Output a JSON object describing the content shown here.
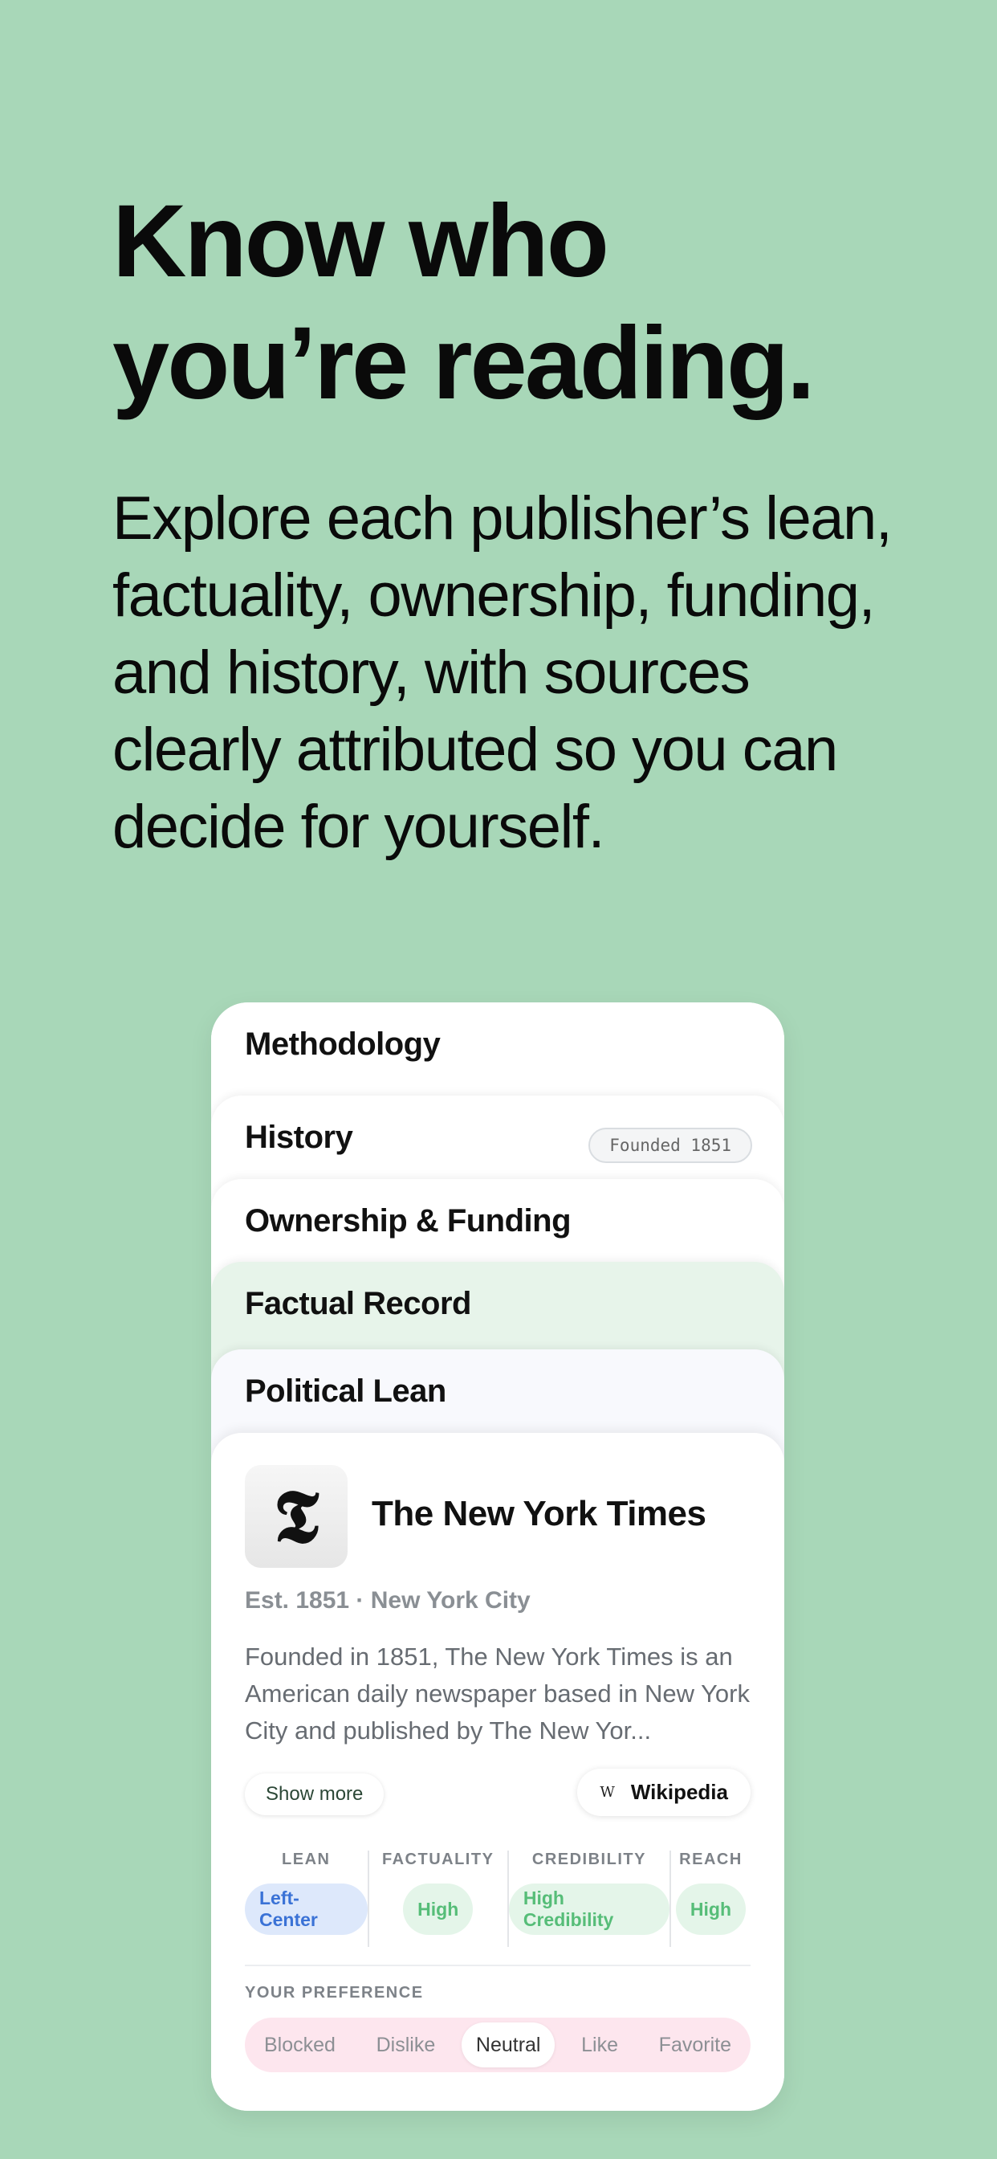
{
  "headline": {
    "line1": "Know who",
    "line2": "you’re reading."
  },
  "subhead": "Explore each publisher’s lean, factuality, ownership, funding, and history, with sources clearly attributed so you can decide for yourself.",
  "stack": {
    "methodology": "Methodology",
    "history": "History",
    "founded_badge": "Founded 1851",
    "ownership": "Ownership & Funding",
    "factual": "Factual Record",
    "political": "Political Lean"
  },
  "publisher": {
    "logo_glyph": "𝕿",
    "name": "The New York Times",
    "meta": "Est. 1851 · New York City",
    "description": "Founded in 1851, The New York Times is an American daily newspaper based in New York City and published by The New Yor...",
    "show_more": "Show more",
    "wiki_icon": "W",
    "wiki_label": "Wikipedia"
  },
  "metrics": [
    {
      "label": "LEAN",
      "value": "Left-Center",
      "color": "#3a72d6"
    },
    {
      "label": "FACTUALITY",
      "value": "High",
      "color": "#56bd78"
    },
    {
      "label": "CREDIBILITY",
      "value": "High Credibility",
      "color": "#56bd78"
    },
    {
      "label": "REACH",
      "value": "High",
      "color": "#56bd78"
    }
  ],
  "preference": {
    "label": "YOUR PREFERENCE",
    "options": [
      "Blocked",
      "Dislike",
      "Neutral",
      "Like",
      "Favorite"
    ],
    "selected": "Neutral"
  },
  "colors": {
    "background": "#a8d7b8",
    "accent_green": "#56bd78",
    "accent_blue": "#3a72d6",
    "pref_bar": "#fde6ee"
  }
}
